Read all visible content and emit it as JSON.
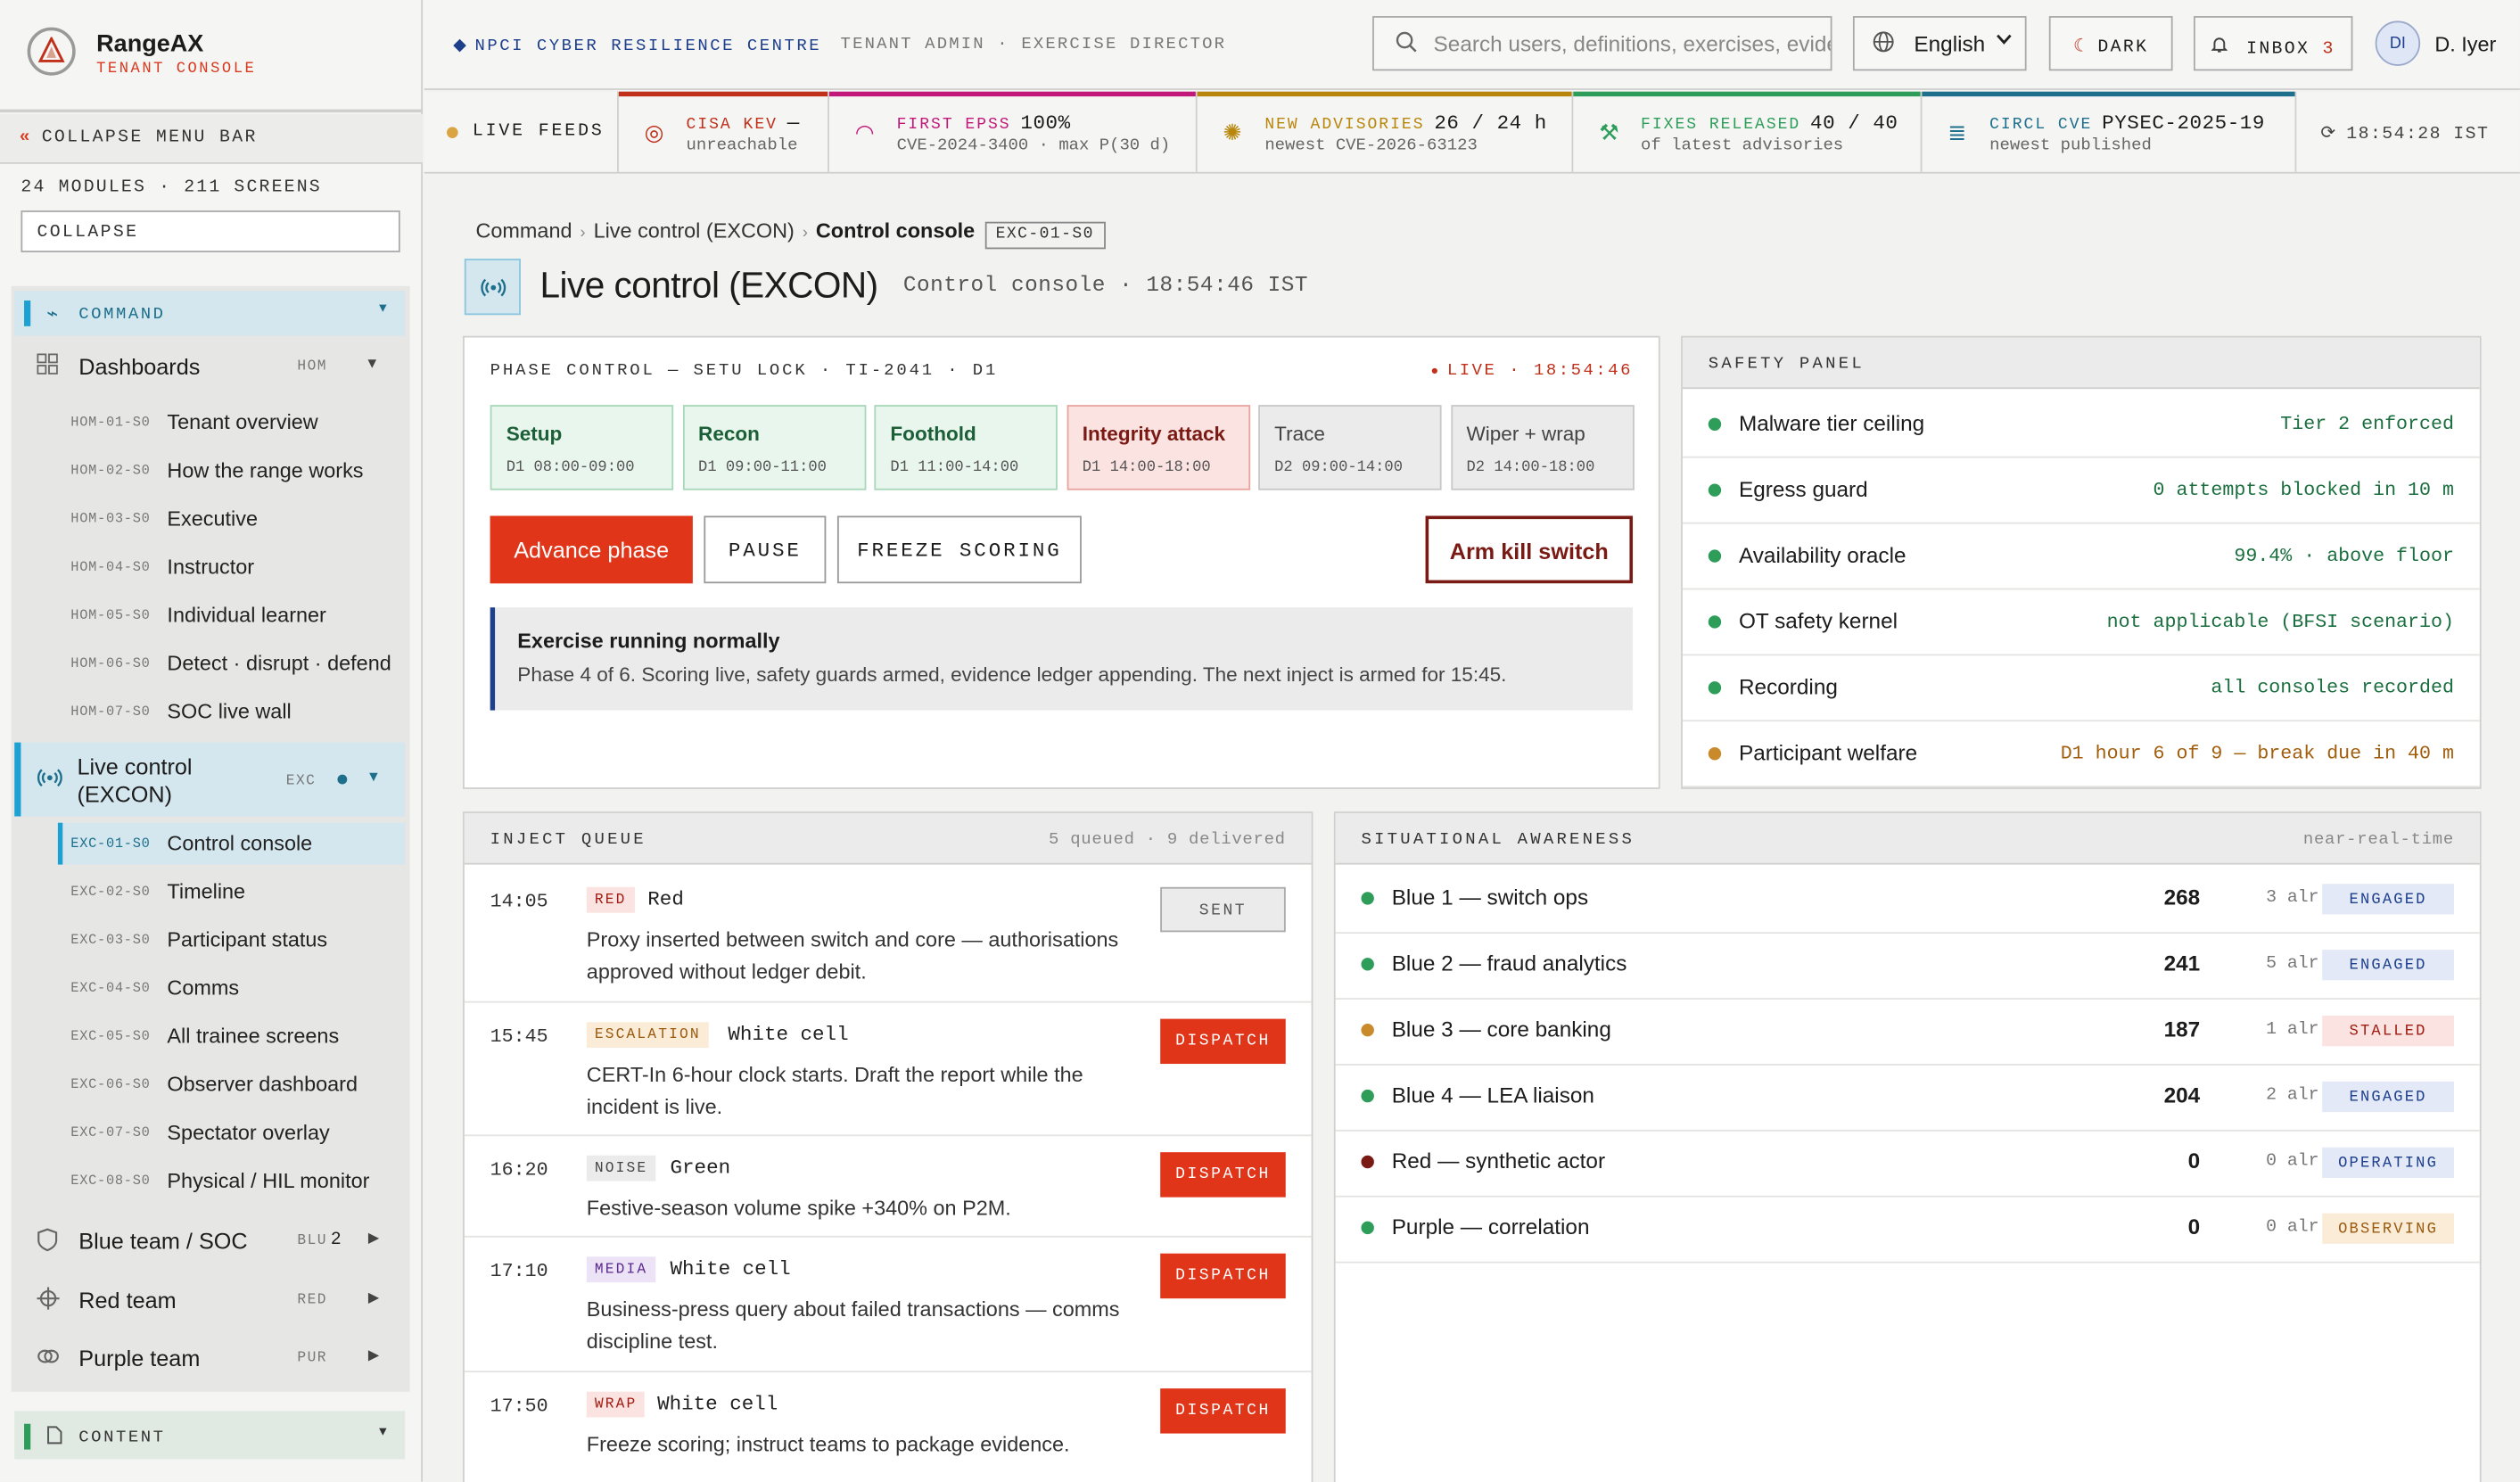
{
  "brand": {
    "title": "RangeAX",
    "subtitle": "TENANT CONSOLE",
    "collapse_bar": "COLLAPSE MENU BAR",
    "module_count": "24 MODULES · 211 SCREENS",
    "collapse_input": "COLLAPSE"
  },
  "nav": {
    "command": "COMMAND",
    "dashboards": {
      "label": "Dashboards",
      "code": "HOM"
    },
    "hom_items": [
      {
        "code": "HOM-01-S0",
        "label": "Tenant overview"
      },
      {
        "code": "HOM-02-S0",
        "label": "How the range works"
      },
      {
        "code": "HOM-03-S0",
        "label": "Executive"
      },
      {
        "code": "HOM-04-S0",
        "label": "Instructor"
      },
      {
        "code": "HOM-05-S0",
        "label": "Individual learner"
      },
      {
        "code": "HOM-06-S0",
        "label": "Detect · disrupt · defend"
      },
      {
        "code": "HOM-07-S0",
        "label": "SOC live wall"
      }
    ],
    "live_control": {
      "label_1": "Live control",
      "label_2": "(EXCON)",
      "code": "EXC"
    },
    "exc_items": [
      {
        "code": "EXC-01-S0",
        "label": "Control console"
      },
      {
        "code": "EXC-02-S0",
        "label": "Timeline"
      },
      {
        "code": "EXC-03-S0",
        "label": "Participant status"
      },
      {
        "code": "EXC-04-S0",
        "label": "Comms"
      },
      {
        "code": "EXC-05-S0",
        "label": "All trainee screens"
      },
      {
        "code": "EXC-06-S0",
        "label": "Observer dashboard"
      },
      {
        "code": "EXC-07-S0",
        "label": "Spectator overlay"
      },
      {
        "code": "EXC-08-S0",
        "label": "Physical / HIL monitor"
      }
    ],
    "blue": {
      "label": "Blue team / SOC",
      "code": "BLU",
      "count": "2"
    },
    "red": {
      "label": "Red team",
      "code": "RED"
    },
    "purple": {
      "label": "Purple team",
      "code": "PUR"
    },
    "content": "CONTENT"
  },
  "topbar": {
    "org": "NPCI CYBER RESILIENCE CENTRE",
    "role": "TENANT ADMIN · EXERCISE DIRECTOR",
    "search_placeholder": "Search users, definitions, exercises, evidence",
    "language": "English",
    "dark": "DARK",
    "inbox": "INBOX",
    "inbox_count": "3",
    "avatar": "DI",
    "user": "D. Iyer"
  },
  "feeds": {
    "live": "LIVE FEEDS",
    "items": [
      {
        "title": "CISA KEV",
        "value": "—",
        "sub": "unreachable",
        "color": "#c0301a"
      },
      {
        "title": "FIRST EPSS",
        "value": "100%",
        "sub": "CVE-2024-3400 · max P(30 d)",
        "color": "#c2187a"
      },
      {
        "title": "NEW ADVISORIES",
        "value": "26 / 24 h",
        "sub": "newest CVE-2026-63123",
        "color": "#b8860b"
      },
      {
        "title": "FIXES RELEASED",
        "value": "40 / 40",
        "sub": "of latest advisories",
        "color": "#2e9d5a"
      },
      {
        "title": "CIRCL CVE",
        "value": "PYSEC-2025-19",
        "sub": "newest published",
        "color": "#1d6f8c"
      }
    ],
    "clock": "18:54:28 IST"
  },
  "breadcrumb": {
    "a": "Command",
    "b": "Live control (EXCON)",
    "c": "Control console",
    "tag": "EXC-01-S0"
  },
  "page": {
    "title": "Live control (EXCON)",
    "subtitle": "Control console · 18:54:46 IST"
  },
  "phase": {
    "title": "PHASE CONTROL — SETU LOCK · TI-2041 · D1",
    "live": "LIVE · 18:54:46",
    "phases": [
      {
        "name": "Setup",
        "time": "D1 08:00-09:00",
        "state": "done"
      },
      {
        "name": "Recon",
        "time": "D1 09:00-11:00",
        "state": "done"
      },
      {
        "name": "Foothold",
        "time": "D1 11:00-14:00",
        "state": "done"
      },
      {
        "name": "Integrity attack",
        "time": "D1 14:00-18:00",
        "state": "current"
      },
      {
        "name": "Trace",
        "time": "D2 09:00-14:00",
        "state": "future"
      },
      {
        "name": "Wiper + wrap",
        "time": "D2 14:00-18:00",
        "state": "future"
      }
    ],
    "advance": "Advance phase",
    "pause": "PAUSE",
    "freeze": "FREEZE SCORING",
    "kill": "Arm kill switch",
    "status_head": "Exercise running normally",
    "status_body": "Phase 4 of 6. Scoring live, safety guards armed, evidence ledger appending. The next inject is armed for 15:45."
  },
  "safety": {
    "title": "SAFETY PANEL",
    "rows": [
      {
        "label": "Malware tier ceiling",
        "value": "Tier 2 enforced",
        "status": "ok"
      },
      {
        "label": "Egress guard",
        "value": "0 attempts blocked in 10 m",
        "status": "ok"
      },
      {
        "label": "Availability oracle",
        "value": "99.4% · above floor",
        "status": "ok"
      },
      {
        "label": "OT safety kernel",
        "value": "not applicable (BFSI scenario)",
        "status": "ok"
      },
      {
        "label": "Recording",
        "value": "all consoles recorded",
        "status": "ok"
      },
      {
        "label": "Participant welfare",
        "value": "D1 hour 6 of 9 — break due in 40 m",
        "status": "warn"
      }
    ]
  },
  "inject": {
    "title": "INJECT QUEUE",
    "meta": "5 queued · 9 delivered",
    "rows": [
      {
        "time": "14:05",
        "tag": "RED",
        "who": "Red",
        "desc": "Proxy inserted between switch and core — authorisations approved without ledger debit.",
        "action": "SENT"
      },
      {
        "time": "15:45",
        "tag": "ESCALATION",
        "who": "White cell",
        "desc": "CERT-In 6-hour clock starts. Draft the report while the incident is live.",
        "action": "DISPATCH"
      },
      {
        "time": "16:20",
        "tag": "NOISE",
        "who": "Green",
        "desc": "Festive-season volume spike +340% on P2M.",
        "action": "DISPATCH"
      },
      {
        "time": "17:10",
        "tag": "MEDIA",
        "who": "White cell",
        "desc": "Business-press query about failed transactions — comms discipline test.",
        "action": "DISPATCH"
      },
      {
        "time": "17:50",
        "tag": "WRAP",
        "who": "White cell",
        "desc": "Freeze scoring; instruct teams to package evidence.",
        "action": "DISPATCH"
      }
    ]
  },
  "awareness": {
    "title": "SITUATIONAL AWARENESS",
    "meta": "near-real-time",
    "rows": [
      {
        "team": "Blue 1 — switch ops",
        "score": "268",
        "alerts": "3 alr",
        "state": "ENGAGED",
        "dot": "#2e9d5a"
      },
      {
        "team": "Blue 2 — fraud analytics",
        "score": "241",
        "alerts": "5 alr",
        "state": "ENGAGED",
        "dot": "#2e9d5a"
      },
      {
        "team": "Blue 3 — core banking",
        "score": "187",
        "alerts": "1 alr",
        "state": "STALLED",
        "dot": "#c98a2b"
      },
      {
        "team": "Blue 4 — LEA liaison",
        "score": "204",
        "alerts": "2 alr",
        "state": "ENGAGED",
        "dot": "#2e9d5a"
      },
      {
        "team": "Red — synthetic actor",
        "score": "0",
        "alerts": "0 alr",
        "state": "OPERATING",
        "dot": "#7a1a14"
      },
      {
        "team": "Purple — correlation",
        "score": "0",
        "alerts": "0 alr",
        "state": "OBSERVING",
        "dot": "#2e9d5a"
      }
    ]
  },
  "colors": {
    "accent": "#e03519",
    "cyan": "#1da1d2",
    "ok": "#2e9d5a",
    "warn": "#c98a2b"
  }
}
